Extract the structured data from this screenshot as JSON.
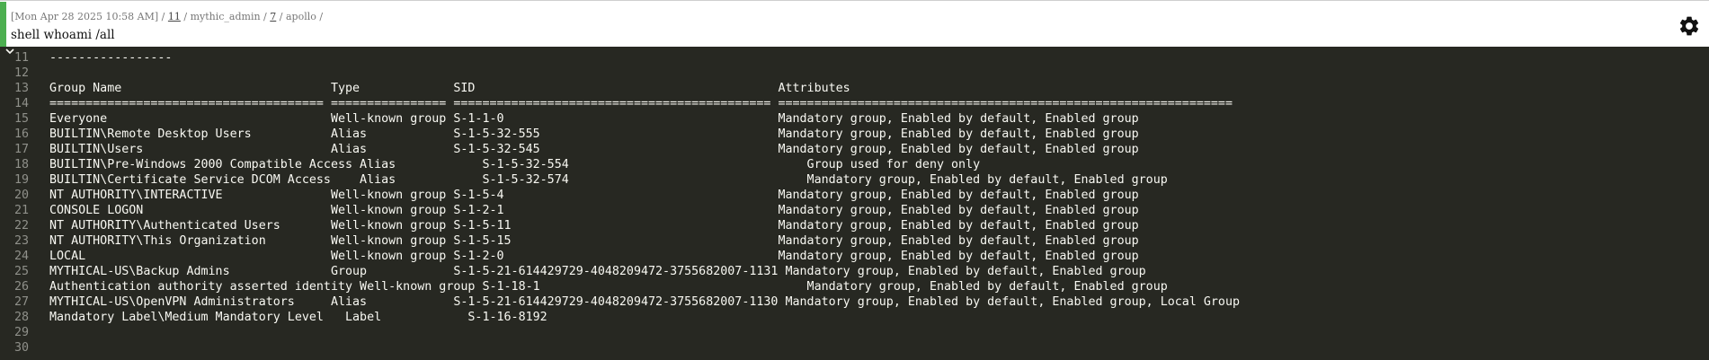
{
  "header": {
    "timestamp": "[Mon Apr 28 2025 10:58 AM]",
    "sep1": " / ",
    "task_id": "11",
    "sep2": " / ",
    "operator": "mythic_admin",
    "sep3": " / ",
    "callback_id": "7",
    "sep4": " / ",
    "agent": "apollo",
    "sep5": " /",
    "command": "shell whoami /all",
    "settings_icon": "gear-icon",
    "accent_color": "#4caf50"
  },
  "output": {
    "collapse_icon": "chevron-down-icon",
    "lines": [
      {
        "n": "11",
        "text": "-----------------"
      },
      {
        "n": "12",
        "text": ""
      },
      {
        "n": "13",
        "text": "Group Name                             Type             SID                                          Attributes"
      },
      {
        "n": "14",
        "text": "====================================== ================ ============================================ ==============================================================="
      },
      {
        "n": "15",
        "text": "Everyone                               Well-known group S-1-1-0                                      Mandatory group, Enabled by default, Enabled group"
      },
      {
        "n": "16",
        "text": "BUILTIN\\Remote Desktop Users           Alias            S-1-5-32-555                                 Mandatory group, Enabled by default, Enabled group"
      },
      {
        "n": "17",
        "text": "BUILTIN\\Users                          Alias            S-1-5-32-545                                 Mandatory group, Enabled by default, Enabled group"
      },
      {
        "n": "18",
        "text": "BUILTIN\\Pre-Windows 2000 Compatible Access Alias            S-1-5-32-554                                 Group used for deny only"
      },
      {
        "n": "19",
        "text": "BUILTIN\\Certificate Service DCOM Access    Alias            S-1-5-32-574                                 Mandatory group, Enabled by default, Enabled group"
      },
      {
        "n": "20",
        "text": "NT AUTHORITY\\INTERACTIVE               Well-known group S-1-5-4                                      Mandatory group, Enabled by default, Enabled group"
      },
      {
        "n": "21",
        "text": "CONSOLE LOGON                          Well-known group S-1-2-1                                      Mandatory group, Enabled by default, Enabled group"
      },
      {
        "n": "22",
        "text": "NT AUTHORITY\\Authenticated Users       Well-known group S-1-5-11                                     Mandatory group, Enabled by default, Enabled group"
      },
      {
        "n": "23",
        "text": "NT AUTHORITY\\This Organization         Well-known group S-1-5-15                                     Mandatory group, Enabled by default, Enabled group"
      },
      {
        "n": "24",
        "text": "LOCAL                                  Well-known group S-1-2-0                                      Mandatory group, Enabled by default, Enabled group"
      },
      {
        "n": "25",
        "text": "MYTHICAL-US\\Backup Admins              Group            S-1-5-21-614429729-4048209472-3755682007-1131 Mandatory group, Enabled by default, Enabled group"
      },
      {
        "n": "26",
        "text": "Authentication authority asserted identity Well-known group S-1-18-1                                     Mandatory group, Enabled by default, Enabled group"
      },
      {
        "n": "27",
        "text": "MYTHICAL-US\\OpenVPN Administrators     Alias            S-1-5-21-614429729-4048209472-3755682007-1130 Mandatory group, Enabled by default, Enabled group, Local Group"
      },
      {
        "n": "28",
        "text": "Mandatory Label\\Medium Mandatory Level   Label            S-1-16-8192"
      },
      {
        "n": "29",
        "text": ""
      },
      {
        "n": "30",
        "text": ""
      }
    ]
  }
}
